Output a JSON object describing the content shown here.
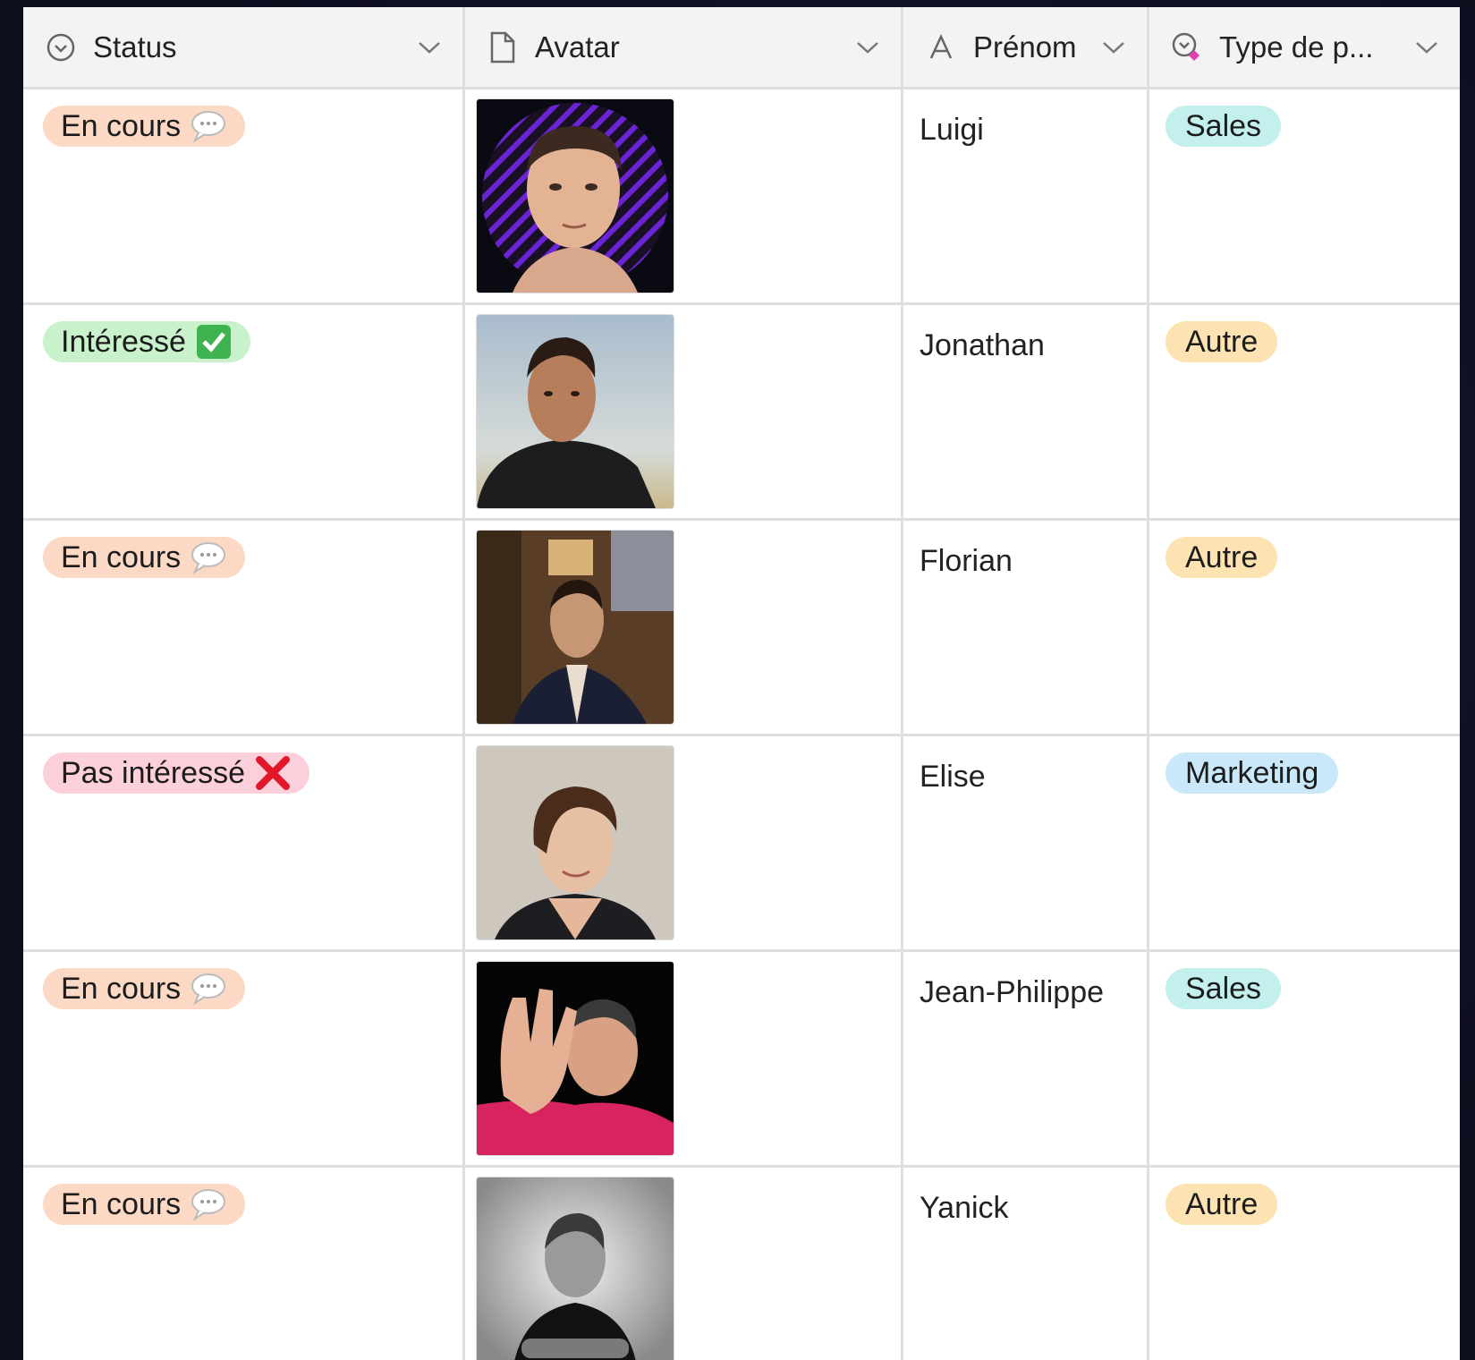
{
  "columns": [
    {
      "label": "Status",
      "icon": "status-select-icon"
    },
    {
      "label": "Avatar",
      "icon": "file-icon"
    },
    {
      "label": "Prénom",
      "icon": "text-field-icon"
    },
    {
      "label": "Type de p...",
      "icon": "multi-select-icon"
    }
  ],
  "rows": [
    {
      "status": "En cours",
      "status_emoji": "speech-bubble-icon",
      "avatar": "avatar-photo-luigi",
      "prenom": "Luigi",
      "type": "Sales"
    },
    {
      "status": "Intéressé",
      "status_emoji": "check-mark-button-icon",
      "avatar": "avatar-photo-jonathan",
      "prenom": "Jonathan",
      "type": "Autre"
    },
    {
      "status": "En cours",
      "status_emoji": "speech-bubble-icon",
      "avatar": "avatar-photo-florian",
      "prenom": "Florian",
      "type": "Autre"
    },
    {
      "status": "Pas intéressé",
      "status_emoji": "cross-mark-icon",
      "avatar": "avatar-photo-elise",
      "prenom": "Elise",
      "type": "Marketing"
    },
    {
      "status": "En cours",
      "status_emoji": "speech-bubble-icon",
      "avatar": "avatar-photo-jean-philippe",
      "prenom": "Jean-Philippe",
      "type": "Sales"
    },
    {
      "status": "En cours",
      "status_emoji": "speech-bubble-icon",
      "avatar": "avatar-photo-yanick",
      "prenom": "Yanick",
      "type": "Autre"
    }
  ],
  "colors": {
    "status_en_cours": "#fbd9c4",
    "status_interesse": "#c9f1cb",
    "status_pas_interesse": "#fbd0db",
    "type_sales": "#c3f0ec",
    "type_autre": "#fde3b2",
    "type_marketing": "#c9e9fb"
  }
}
